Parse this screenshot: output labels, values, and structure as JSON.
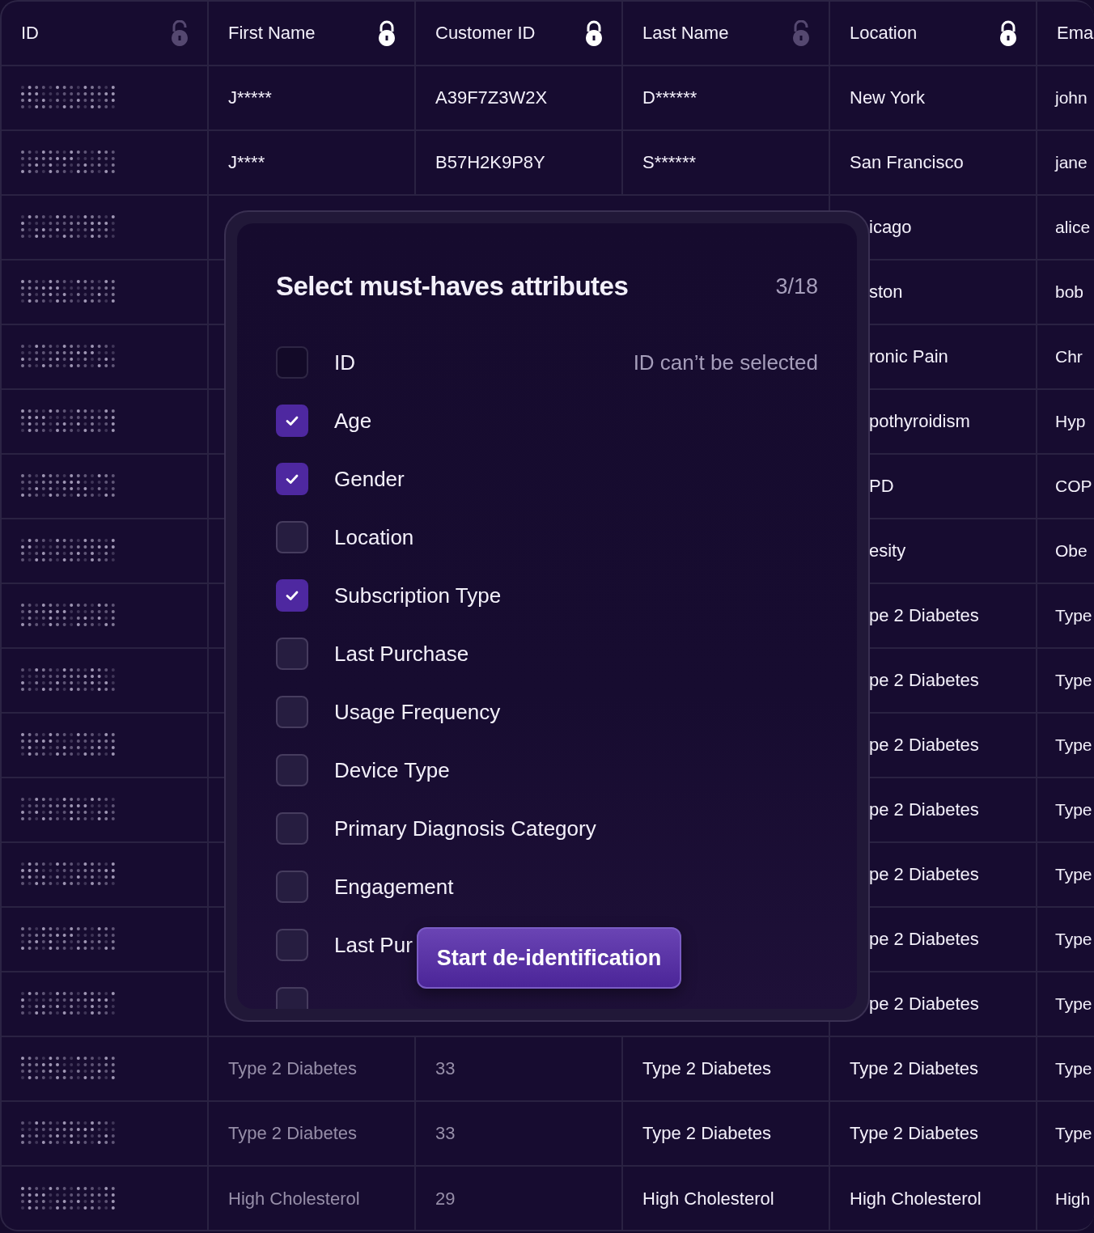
{
  "table": {
    "columns": [
      {
        "label": "ID",
        "locked": false
      },
      {
        "label": "First Name",
        "locked": true
      },
      {
        "label": "Customer ID",
        "locked": true
      },
      {
        "label": "Last Name",
        "locked": false
      },
      {
        "label": "Location",
        "locked": true
      },
      {
        "label": "Ema"
      }
    ],
    "rows": [
      {
        "covered": false,
        "first_name": "J*****",
        "customer_id": "A39F7Z3W2X",
        "last_name": "D******",
        "location": "New York",
        "email": "john"
      },
      {
        "covered": false,
        "first_name": "J****",
        "customer_id": "B57H2K9P8Y",
        "last_name": "S******",
        "location": "San Francisco",
        "email": "jane"
      },
      {
        "covered": true,
        "location": "icago",
        "email": "alice"
      },
      {
        "covered": true,
        "location": "ston",
        "email": "bob"
      },
      {
        "covered": true,
        "location": "ronic Pain",
        "email": "Chr"
      },
      {
        "covered": true,
        "location": "pothyroidism",
        "email": "Hyp"
      },
      {
        "covered": true,
        "location": "PD",
        "email": "COP"
      },
      {
        "covered": true,
        "location": "esity",
        "email": "Obe"
      },
      {
        "covered": true,
        "location": "pe 2 Diabetes",
        "email": "Type"
      },
      {
        "covered": true,
        "location": "pe 2 Diabetes",
        "email": "Type"
      },
      {
        "covered": true,
        "location": "pe 2 Diabetes",
        "email": "Type"
      },
      {
        "covered": true,
        "location": "pe 2 Diabetes",
        "email": "Type"
      },
      {
        "covered": true,
        "location": "pe 2 Diabetes",
        "email": "Type"
      },
      {
        "covered": true,
        "location": "pe 2 Diabetes",
        "email": "Type"
      },
      {
        "covered": true,
        "location": "pe 2 Diabetes",
        "email": "Type"
      },
      {
        "covered": false,
        "faded": true,
        "first_name": "Type 2 Diabetes",
        "customer_id": "33",
        "last_name": "Type 2 Diabetes",
        "location": "Type 2 Diabetes",
        "email": "Type"
      },
      {
        "covered": false,
        "faded": true,
        "first_name": "Type 2 Diabetes",
        "customer_id": "33",
        "last_name": "Type 2 Diabetes",
        "location": "Type 2 Diabetes",
        "email": "Type"
      },
      {
        "covered": false,
        "faded": true,
        "first_name": "High Cholesterol",
        "customer_id": "29",
        "last_name": "High Cholesterol",
        "location": "High Cholesterol",
        "email": "High"
      }
    ]
  },
  "dialog": {
    "title": "Select must-haves attributes",
    "count": "3/18",
    "attributes": [
      {
        "label": "ID",
        "checked": false,
        "disabled": true,
        "note": "ID can’t be selected"
      },
      {
        "label": "Age",
        "checked": true,
        "disabled": false
      },
      {
        "label": "Gender",
        "checked": true,
        "disabled": false
      },
      {
        "label": "Location",
        "checked": false,
        "disabled": false
      },
      {
        "label": "Subscription Type",
        "checked": true,
        "disabled": false
      },
      {
        "label": "Last Purchase",
        "checked": false,
        "disabled": false
      },
      {
        "label": "Usage Frequency",
        "checked": false,
        "disabled": false
      },
      {
        "label": "Device Type",
        "checked": false,
        "disabled": false
      },
      {
        "label": "Primary Diagnosis Category",
        "checked": false,
        "disabled": false
      },
      {
        "label": "Engagement",
        "checked": false,
        "disabled": false
      },
      {
        "label": "Last Pur",
        "checked": false,
        "disabled": false
      },
      {
        "checked": false,
        "disabled": false
      }
    ],
    "button": "Start de-identification"
  }
}
